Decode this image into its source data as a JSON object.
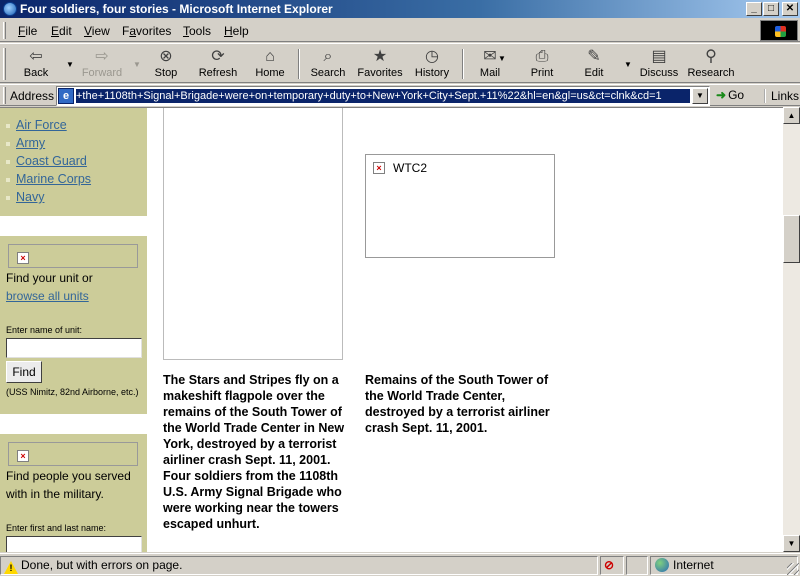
{
  "window": {
    "title": "Four soldiers, four stories - Microsoft Internet Explorer",
    "controls": {
      "minimize": "_",
      "maximize": "□",
      "close": "✕"
    }
  },
  "menu": {
    "items": [
      {
        "label": "File",
        "accel": "F"
      },
      {
        "label": "Edit",
        "accel": "E"
      },
      {
        "label": "View",
        "accel": "V"
      },
      {
        "label": "Favorites",
        "accel": "a"
      },
      {
        "label": "Tools",
        "accel": "T"
      },
      {
        "label": "Help",
        "accel": "H"
      }
    ]
  },
  "toolbar": {
    "back": "Back",
    "forward": "Forward",
    "stop": "Stop",
    "refresh": "Refresh",
    "home": "Home",
    "search": "Search",
    "favorites": "Favorites",
    "history": "History",
    "mail": "Mail",
    "print": "Print",
    "edit": "Edit",
    "discuss": "Discuss",
    "research": "Research"
  },
  "address": {
    "label": "Address",
    "url": "+the+1108th+Signal+Brigade+were+on+temporary+duty+to+New+York+City+Sept.+11%22&hl=en&gl=us&ct=clnk&cd=1",
    "go": "Go",
    "links": "Links"
  },
  "sidebar": {
    "branches": [
      "Air Force",
      "Army",
      "Coast Guard",
      "Marine Corps",
      "Navy"
    ],
    "unit_finder": {
      "prompt": "Find your unit or",
      "browse_link": "browse all units",
      "input_label": "Enter name of unit:",
      "button": "Find",
      "hint": "(USS Nimitz, 82nd Airborne, etc.)"
    },
    "people_finder": {
      "prompt": "Find people you served with in the military.",
      "input_label": "Enter first and last name:"
    }
  },
  "main": {
    "right_image_alt": "WTC2",
    "left_caption": "The Stars and Stripes fly on a makeshift flagpole over the remains of the South Tower of the World Trade Center in New York, destroyed by a terrorist airliner crash Sept. 11, 2001. Four soldiers from the 1108th U.S. Army Signal Brigade who were working near the towers escaped unhurt.",
    "right_caption": "Remains of the South Tower of the World Trade Center, destroyed by a terrorist airliner crash Sept. 11, 2001."
  },
  "status": {
    "text": "Done, but with errors on page.",
    "zone": "Internet"
  }
}
